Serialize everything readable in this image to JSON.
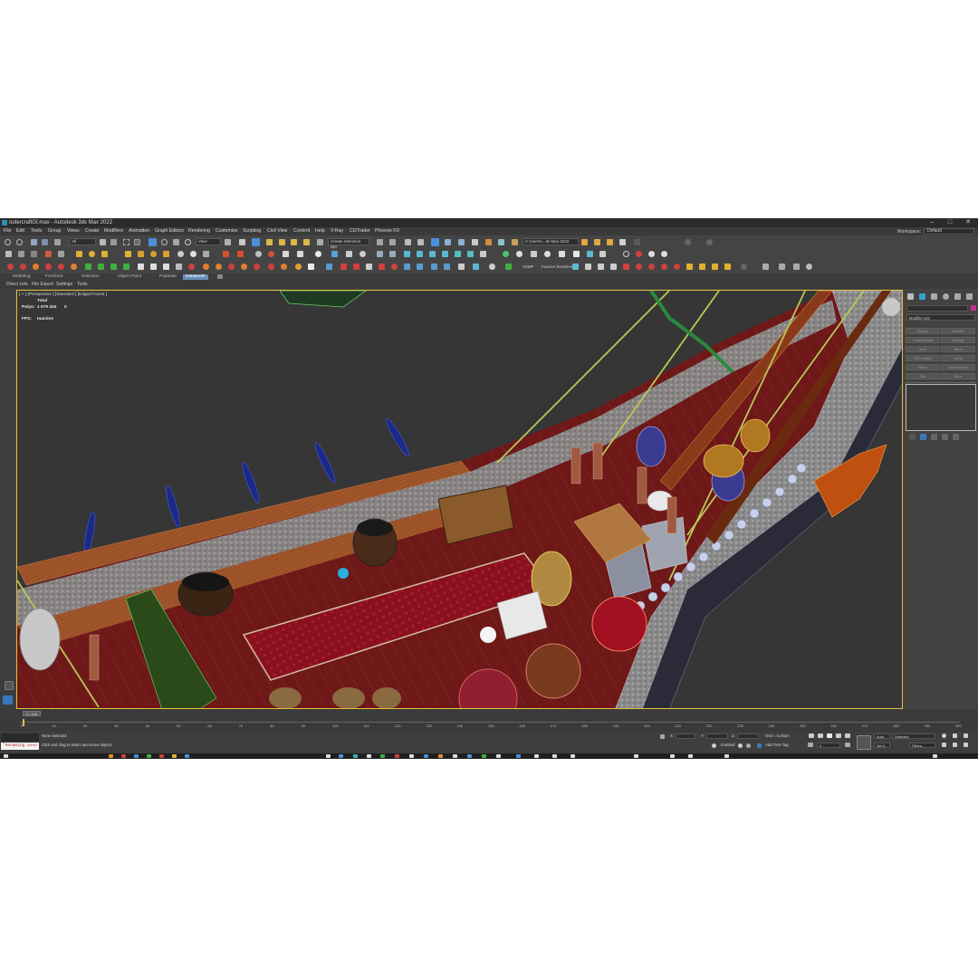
{
  "window": {
    "title": "outercraftGI.max - Autodesk 3ds Max 2022",
    "controls": {
      "minimize": "–",
      "maximize": "□",
      "close": "✕"
    }
  },
  "menubar": {
    "items": [
      "File",
      "Edit",
      "Tools",
      "Group",
      "Views",
      "Create",
      "Modifiers",
      "Animation",
      "Graph Editors",
      "Rendering",
      "Customize",
      "Scripting",
      "Civil View",
      "Content",
      "Help",
      "V-Ray",
      "CGTrader",
      "Phoenix FD"
    ],
    "workspace_label": "Workspace:",
    "workspace_value": "Default"
  },
  "toolbar": {
    "filter_value": "All",
    "refcoord_value": "View",
    "selection_set_value": "Create Selection Set",
    "path_value": "C:\\Users\\...ds Max 2022",
    "xsmp_label": "XSMP",
    "render_label": "Inactive Renderer",
    "accent": "#4a90d9"
  },
  "ribbon": {
    "tabs": [
      "Modeling",
      "Freeform",
      "Selection",
      "Object Paint",
      "Populate",
      "Datasmith"
    ],
    "active": "Datasmith"
  },
  "subtabs": [
    "Direct Link",
    "File Export",
    "Settings",
    "Tools"
  ],
  "viewport": {
    "label": "[ + ] [Perspective ] [Standard ] [Edged Faces ]",
    "total_label": "Total",
    "polys_label": "Polys:",
    "polys_value": "1 679 434",
    "polys_sel": "0",
    "fps_label": "FPS:",
    "fps_value": "Inactive",
    "border_color": "#e0c040",
    "bg_color": "#363636"
  },
  "command_panel": {
    "modifier_list": "Modifier List",
    "buttons": [
      "Unwrap",
      "Smooth",
      "TurboSmooth",
      "Unwrap",
      "Shell",
      "Bend",
      "FFD Select",
      "Lathe",
      "Relax",
      "Mesh Select",
      "Edit",
      "Slice"
    ]
  },
  "timeline": {
    "slider_label": "0 / 100",
    "ticks": [
      "0",
      "10",
      "20",
      "30",
      "40",
      "50",
      "60",
      "70",
      "80",
      "90",
      "100",
      "110",
      "120",
      "130",
      "140",
      "150",
      "160",
      "170",
      "180",
      "190",
      "200",
      "210",
      "220",
      "230",
      "240",
      "250",
      "260",
      "270",
      "280",
      "290",
      "300"
    ]
  },
  "status": {
    "maxscript": "\"Renaming assu",
    "none_selected": "None Selected",
    "hint": "Click and drag to select and move objects",
    "x_label": "X:",
    "y_label": "Y:",
    "z_label": "Z:",
    "grid": "Grid = 0,254m",
    "enabled_label": "Enabled:",
    "add_time_tag": "Add Time Tag",
    "auto_label": "Auto",
    "set_k_label": "Set K.",
    "selected_value": "Selected",
    "filters_label": "Filters...",
    "frame_value": "0"
  }
}
